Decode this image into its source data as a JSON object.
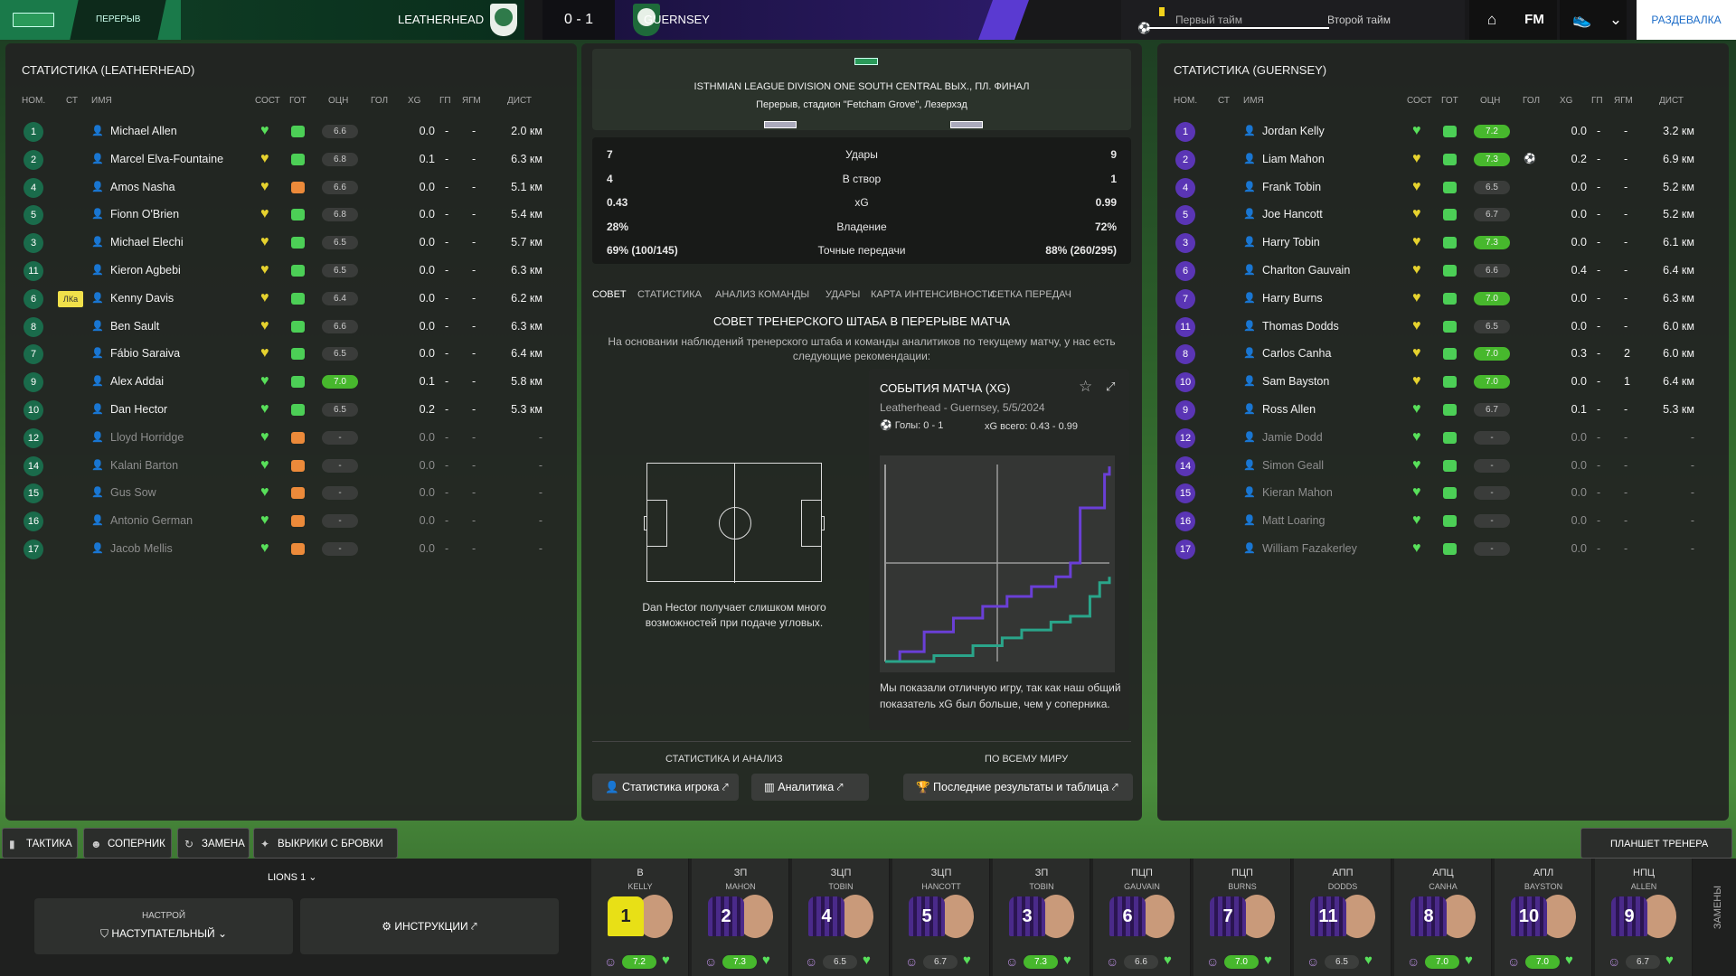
{
  "topbar": {
    "period": "ПЕРЕРЫВ",
    "home_team": "LEATHERHEAD",
    "away_team": "GUERNSEY",
    "score": "0 - 1",
    "first_half": "Первый тайм",
    "second_half": "Второй тайм",
    "fm": "FM",
    "locker": "РАЗДЕВАЛКА"
  },
  "left": {
    "title": "СТАТИСТИКА (LEATHERHEAD)",
    "headers": {
      "num": "НОМ.",
      "st": "СТ",
      "name": "ИМЯ",
      "cond": "СОСТ",
      "ready": "ГОТ",
      "rating": "ОЦН",
      "goals": "ГОЛ",
      "xg": "XG",
      "gp": "ГП",
      "ygm": "ЯГМ",
      "dist": "ДИСТ"
    },
    "players": [
      {
        "num": "1",
        "name": "Michael Allen",
        "rating": "6.6",
        "xg": "0.0",
        "gp": "-",
        "yg": "-",
        "dist": "2.0 км",
        "heart": "g",
        "fit": "g",
        "hl": false
      },
      {
        "num": "2",
        "name": "Marcel Elva-Fountaine",
        "rating": "6.8",
        "xg": "0.1",
        "gp": "-",
        "yg": "-",
        "dist": "6.3 км",
        "heart": "y",
        "fit": "g",
        "hl": false
      },
      {
        "num": "4",
        "name": "Amos Nasha",
        "rating": "6.6",
        "xg": "0.0",
        "gp": "-",
        "yg": "-",
        "dist": "5.1 км",
        "heart": "y",
        "fit": "o",
        "hl": false
      },
      {
        "num": "5",
        "name": "Fionn O'Brien",
        "rating": "6.8",
        "xg": "0.0",
        "gp": "-",
        "yg": "-",
        "dist": "5.4 км",
        "heart": "y",
        "fit": "g",
        "hl": false
      },
      {
        "num": "3",
        "name": "Michael Elechi",
        "rating": "6.5",
        "xg": "0.0",
        "gp": "-",
        "yg": "-",
        "dist": "5.7 км",
        "heart": "y",
        "fit": "g",
        "hl": false
      },
      {
        "num": "11",
        "name": "Kieron Agbebi",
        "rating": "6.5",
        "xg": "0.0",
        "gp": "-",
        "yg": "-",
        "dist": "6.3 км",
        "heart": "y",
        "fit": "g",
        "hl": false
      },
      {
        "num": "6",
        "name": "Kenny Davis",
        "rating": "6.4",
        "xg": "0.0",
        "gp": "-",
        "yg": "-",
        "dist": "6.2 км",
        "heart": "y",
        "fit": "g",
        "hl": false,
        "captain": "ЛКа"
      },
      {
        "num": "8",
        "name": "Ben Sault",
        "rating": "6.6",
        "xg": "0.0",
        "gp": "-",
        "yg": "-",
        "dist": "6.3 км",
        "heart": "y",
        "fit": "g",
        "hl": false
      },
      {
        "num": "7",
        "name": "Fábio Saraiva",
        "rating": "6.5",
        "xg": "0.0",
        "gp": "-",
        "yg": "-",
        "dist": "6.4 км",
        "heart": "y",
        "fit": "g",
        "hl": false
      },
      {
        "num": "9",
        "name": "Alex Addai",
        "rating": "7.0",
        "xg": "0.1",
        "gp": "-",
        "yg": "-",
        "dist": "5.8 км",
        "heart": "g",
        "fit": "g",
        "hl": true
      },
      {
        "num": "10",
        "name": "Dan Hector",
        "rating": "6.5",
        "xg": "0.2",
        "gp": "-",
        "yg": "-",
        "dist": "5.3 км",
        "heart": "g",
        "fit": "g",
        "hl": false
      },
      {
        "num": "12",
        "name": "Lloyd Horridge",
        "rating": "-",
        "xg": "0.0",
        "gp": "-",
        "yg": "-",
        "dist": "-",
        "heart": "g",
        "fit": "o",
        "hl": false,
        "sub": true
      },
      {
        "num": "14",
        "name": "Kalani Barton",
        "rating": "-",
        "xg": "0.0",
        "gp": "-",
        "yg": "-",
        "dist": "-",
        "heart": "g",
        "fit": "o",
        "hl": false,
        "sub": true
      },
      {
        "num": "15",
        "name": "Gus Sow",
        "rating": "-",
        "xg": "0.0",
        "gp": "-",
        "yg": "-",
        "dist": "-",
        "heart": "g",
        "fit": "o",
        "hl": false,
        "sub": true
      },
      {
        "num": "16",
        "name": "Antonio German",
        "rating": "-",
        "xg": "0.0",
        "gp": "-",
        "yg": "-",
        "dist": "-",
        "heart": "g",
        "fit": "o",
        "hl": false,
        "sub": true
      },
      {
        "num": "17",
        "name": "Jacob Mellis",
        "rating": "-",
        "xg": "0.0",
        "gp": "-",
        "yg": "-",
        "dist": "-",
        "heart": "g",
        "fit": "o",
        "hl": false,
        "sub": true
      }
    ]
  },
  "right": {
    "title": "СТАТИСТИКА (GUERNSEY)",
    "headers": {
      "num": "НОМ.",
      "st": "СТ",
      "name": "ИМЯ",
      "cond": "СОСТ",
      "ready": "ГОТ",
      "rating": "ОЦН",
      "goals": "ГОЛ",
      "xg": "XG",
      "gp": "ГП",
      "ygm": "ЯГМ",
      "dist": "ДИСТ"
    },
    "players": [
      {
        "num": "1",
        "name": "Jordan Kelly",
        "rating": "7.2",
        "xg": "0.0",
        "gp": "-",
        "yg": "-",
        "dist": "3.2 км",
        "heart": "g",
        "fit": "g",
        "hl": true
      },
      {
        "num": "2",
        "name": "Liam Mahon",
        "rating": "7.3",
        "xg": "0.2",
        "gp": "-",
        "yg": "-",
        "dist": "6.9 км",
        "heart": "y",
        "fit": "g",
        "hl": true,
        "goal": true
      },
      {
        "num": "4",
        "name": "Frank Tobin",
        "rating": "6.5",
        "xg": "0.0",
        "gp": "-",
        "yg": "-",
        "dist": "5.2 км",
        "heart": "y",
        "fit": "g",
        "hl": false
      },
      {
        "num": "5",
        "name": "Joe Hancott",
        "rating": "6.7",
        "xg": "0.0",
        "gp": "-",
        "yg": "-",
        "dist": "5.2 км",
        "heart": "y",
        "fit": "g",
        "hl": false
      },
      {
        "num": "3",
        "name": "Harry Tobin",
        "rating": "7.3",
        "xg": "0.0",
        "gp": "-",
        "yg": "-",
        "dist": "6.1 км",
        "heart": "y",
        "fit": "g",
        "hl": true
      },
      {
        "num": "6",
        "name": "Charlton Gauvain",
        "rating": "6.6",
        "xg": "0.4",
        "gp": "-",
        "yg": "-",
        "dist": "6.4 км",
        "heart": "y",
        "fit": "g",
        "hl": false
      },
      {
        "num": "7",
        "name": "Harry Burns",
        "rating": "7.0",
        "xg": "0.0",
        "gp": "-",
        "yg": "-",
        "dist": "6.3 км",
        "heart": "y",
        "fit": "g",
        "hl": true
      },
      {
        "num": "11",
        "name": "Thomas Dodds",
        "rating": "6.5",
        "xg": "0.0",
        "gp": "-",
        "yg": "-",
        "dist": "6.0 км",
        "heart": "y",
        "fit": "g",
        "hl": false
      },
      {
        "num": "8",
        "name": "Carlos Canha",
        "rating": "7.0",
        "xg": "0.3",
        "gp": "-",
        "yg": "2",
        "dist": "6.0 км",
        "heart": "y",
        "fit": "g",
        "hl": true
      },
      {
        "num": "10",
        "name": "Sam Bayston",
        "rating": "7.0",
        "xg": "0.0",
        "gp": "-",
        "yg": "1",
        "dist": "6.4 км",
        "heart": "y",
        "fit": "e",
        "hl": true
      },
      {
        "num": "9",
        "name": "Ross Allen",
        "rating": "6.7",
        "xg": "0.1",
        "gp": "-",
        "yg": "-",
        "dist": "5.3 км",
        "heart": "g",
        "fit": "g",
        "hl": false
      },
      {
        "num": "12",
        "name": "Jamie Dodd",
        "rating": "-",
        "xg": "0.0",
        "gp": "-",
        "yg": "-",
        "dist": "-",
        "heart": "g",
        "fit": "e",
        "hl": false,
        "sub": true
      },
      {
        "num": "14",
        "name": "Simon Geall",
        "rating": "-",
        "xg": "0.0",
        "gp": "-",
        "yg": "-",
        "dist": "-",
        "heart": "g",
        "fit": "e",
        "hl": false,
        "sub": true
      },
      {
        "num": "15",
        "name": "Kieran Mahon",
        "rating": "-",
        "xg": "0.0",
        "gp": "-",
        "yg": "-",
        "dist": "-",
        "heart": "g",
        "fit": "e",
        "hl": false,
        "sub": true
      },
      {
        "num": "16",
        "name": "Matt Loaring",
        "rating": "-",
        "xg": "0.0",
        "gp": "-",
        "yg": "-",
        "dist": "-",
        "heart": "g",
        "fit": "g",
        "hl": false,
        "sub": true
      },
      {
        "num": "17",
        "name": "William Fazakerley",
        "rating": "-",
        "xg": "0.0",
        "gp": "-",
        "yg": "-",
        "dist": "-",
        "heart": "g",
        "fit": "e",
        "hl": false,
        "sub": true
      }
    ]
  },
  "center": {
    "competition": "ISTHMIAN LEAGUE DIVISION ONE SOUTH CENTRAL ВЫХ., ПЛ. ФИНАЛ",
    "venue": "Перерыв, стадион \"Fetcham Grove\", Лезерхэд",
    "stats": [
      {
        "home": "7",
        "label": "Удары",
        "away": "9"
      },
      {
        "home": "4",
        "label": "В створ",
        "away": "1"
      },
      {
        "home": "0.43",
        "label": "xG",
        "away": "0.99"
      },
      {
        "home": "28%",
        "label": "Владение",
        "away": "72%"
      },
      {
        "home": "69% (100/145)",
        "label": "Точные передачи",
        "away": "88% (260/295)"
      }
    ],
    "tabs": [
      "СОВЕТ",
      "СТАТИСТИКА",
      "АНАЛИЗ КОМАНДЫ",
      "УДАРЫ",
      "КАРТА ИНТЕНСИВНОСТИ",
      "СЕТКА ПЕРЕДАЧ"
    ],
    "advice_title": "СОВЕТ ТРЕНЕРСКОГО ШТАБА В ПЕРЕРЫВЕ МАТЧА",
    "advice_text": "На основании наблюдений тренерского штаба и команды аналитиков по текущему матчу, у нас есть следующие рекомендации:",
    "pitch_caption": "Dan Hector получает слишком много возможностей при подаче угловых.",
    "xg_card": {
      "title": "СОБЫТИЯ МАТЧА (XG)",
      "subtitle": "Leatherhead - Guernsey, 5/5/2024",
      "goals": "Голы: 0 - 1",
      "xg_total": "xG всего: 0.43 - 0.99",
      "footer": "Мы показали отличную игру, так как наш общий показатель xG был больше, чем у соперника."
    },
    "stats_label": "СТАТИСТИКА И АНАЛИЗ",
    "world_label": "ПО ВСЕМУ МИРУ",
    "btn_player_stats": "Статистика игрока",
    "btn_analytics": "Аналитика",
    "btn_results": "Последние результаты и таблица"
  },
  "chart_data": {
    "type": "line",
    "title": "СОБЫТИЯ МАТЧА (XG)",
    "series": [
      {
        "team": "Guernsey",
        "color": "#6a3fd6",
        "points": [
          [
            0,
            0
          ],
          [
            3,
            0.05
          ],
          [
            8,
            0.15
          ],
          [
            14,
            0.22
          ],
          [
            20,
            0.28
          ],
          [
            25,
            0.33
          ],
          [
            30,
            0.38
          ],
          [
            35,
            0.43
          ],
          [
            38,
            0.5
          ],
          [
            40,
            0.78
          ],
          [
            45,
            0.95
          ],
          [
            46,
            0.99
          ]
        ]
      },
      {
        "team": "Leatherhead",
        "color": "#2aa58a",
        "points": [
          [
            0,
            0
          ],
          [
            10,
            0.03
          ],
          [
            18,
            0.08
          ],
          [
            24,
            0.12
          ],
          [
            28,
            0.16
          ],
          [
            34,
            0.2
          ],
          [
            38,
            0.23
          ],
          [
            42,
            0.33
          ],
          [
            44,
            0.4
          ],
          [
            46,
            0.43
          ]
        ]
      }
    ],
    "xlim": [
      0,
      46
    ],
    "ylim": [
      0,
      1.0
    ]
  },
  "bottom": {
    "tabs": [
      "ТАКТИКА",
      "СОПЕРНИК",
      "ЗАМЕНА",
      "ВЫКРИКИ С БРОВКИ"
    ],
    "board": "ПЛАНШЕТ ТРЕНЕРА",
    "lions": "LIONS 1",
    "setup_label": "НАСТРОЙ",
    "setup_value": "НАСТУПАТЕЛЬНЫЙ",
    "instructions": "ИНСТРУКЦИИ",
    "subs": "ЗАМЕНЫ",
    "lineup": [
      {
        "pos": "В",
        "name": "KELLY",
        "num": "1",
        "rating": "7.2",
        "gk": true,
        "hl": true
      },
      {
        "pos": "ЗП",
        "name": "MAHON",
        "num": "2",
        "rating": "7.3",
        "hl": true
      },
      {
        "pos": "ЗЦП",
        "name": "TOBIN",
        "num": "4",
        "rating": "6.5"
      },
      {
        "pos": "ЗЦП",
        "name": "HANCOTT",
        "num": "5",
        "rating": "6.7"
      },
      {
        "pos": "ЗП",
        "name": "TOBIN",
        "num": "3",
        "rating": "7.3",
        "hl": true
      },
      {
        "pos": "ПЦП",
        "name": "GAUVAIN",
        "num": "6",
        "rating": "6.6"
      },
      {
        "pos": "ПЦП",
        "name": "BURNS",
        "num": "7",
        "rating": "7.0",
        "hl": true
      },
      {
        "pos": "АПП",
        "name": "DODDS",
        "num": "11",
        "rating": "6.5"
      },
      {
        "pos": "АПЦ",
        "name": "CANHA",
        "num": "8",
        "rating": "7.0",
        "hl": true
      },
      {
        "pos": "АПЛ",
        "name": "BAYSTON",
        "num": "10",
        "rating": "7.0",
        "hl": true
      },
      {
        "pos": "НПЦ",
        "name": "ALLEN",
        "num": "9",
        "rating": "6.7"
      }
    ]
  }
}
